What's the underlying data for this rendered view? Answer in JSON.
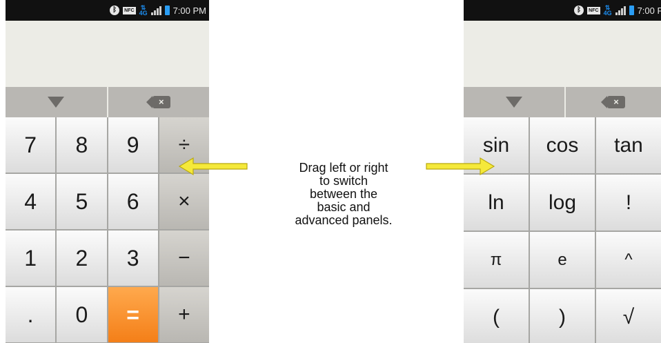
{
  "status_bar": {
    "bluetooth_icon": "bluetooth-icon",
    "nfc_label": "NFC",
    "network_label": "4G",
    "signal_icon": "signal-icon",
    "battery_icon": "battery-icon",
    "time": "7:00 PM"
  },
  "colors": {
    "accent": "#f47f18",
    "status_accent": "#2a9df4",
    "arrow": "#f5e93a"
  },
  "basic_panel": {
    "controls": {
      "collapse_icon": "triangle-down-icon",
      "backspace_icon": "backspace-icon",
      "backspace_glyph": "×"
    },
    "keys": [
      "7",
      "8",
      "9",
      "÷",
      "4",
      "5",
      "6",
      "×",
      "1",
      "2",
      "3",
      "−",
      ".",
      "0",
      "=",
      "+"
    ]
  },
  "advanced_panel": {
    "controls": {
      "collapse_icon": "triangle-down-icon",
      "backspace_icon": "backspace-icon",
      "backspace_glyph": "×"
    },
    "keys": [
      "sin",
      "cos",
      "tan",
      "ln",
      "log",
      "!",
      "π",
      "e",
      "^",
      "(",
      ")",
      "√"
    ]
  },
  "caption": {
    "lines": [
      "Drag left or right",
      "to switch",
      "between the",
      "basic and",
      "advanced panels."
    ]
  }
}
